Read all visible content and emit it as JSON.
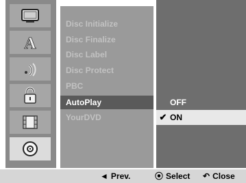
{
  "sidebar": {
    "icons": [
      {
        "name": "tv-icon",
        "selected": false
      },
      {
        "name": "language-icon",
        "selected": false
      },
      {
        "name": "audio-icon",
        "selected": false
      },
      {
        "name": "lock-icon",
        "selected": false
      },
      {
        "name": "recording-icon",
        "selected": false
      },
      {
        "name": "disc-icon",
        "selected": true
      }
    ]
  },
  "menu": {
    "items": [
      "Disc Initialize",
      "Disc Finalize",
      "Disc Label",
      "Disc Protect",
      "PBC",
      "AutoPlay",
      "YourDVD"
    ],
    "active_index": 5
  },
  "options": {
    "off_label": "OFF",
    "on_label": "ON",
    "check_glyph": "✔",
    "selected": "ON"
  },
  "footer": {
    "prev_glyph": "◄",
    "prev_label": "Prev.",
    "select_glyph": "⦿",
    "select_label": "Select",
    "close_glyph": "↶",
    "close_label": "Close"
  }
}
